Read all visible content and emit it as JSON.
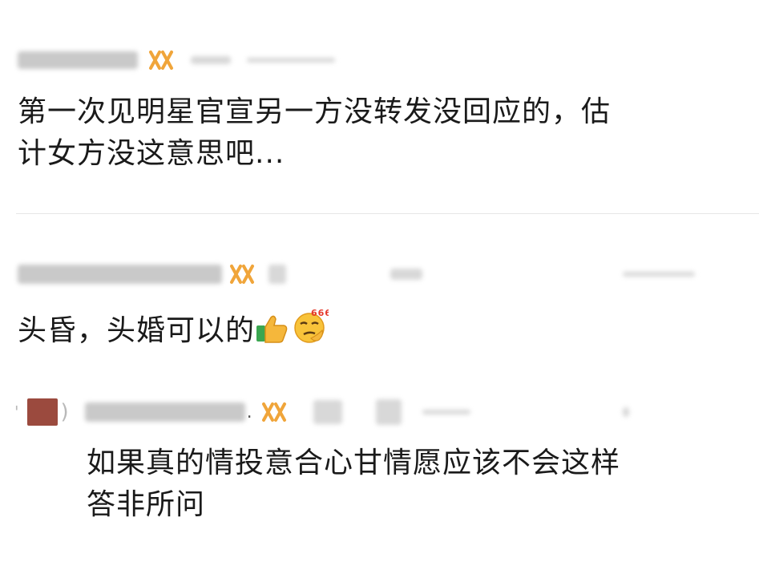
{
  "comments": [
    {
      "text": "第一次见明星官宣另一方没转发没回应的，估计女方没这意思吧...",
      "line1": "第一次见明星官宣另一方没转发没回应的，估",
      "line2": "计女方没这意思吧..."
    },
    {
      "text": "头昏，头婚可以的",
      "reactions": [
        "thumbs-up-icon",
        "666-face-icon"
      ],
      "badge": "666"
    },
    {
      "text": "如果真的情投意合心甘情愿应该不会这样答非所问",
      "line1": "如果真的情投意合心甘情愿应该不会这样",
      "line2": "答非所问",
      "is_reply": true
    }
  ],
  "colors": {
    "vip_icon": "#f0a53a",
    "divider": "#e6e6e6",
    "text": "#1a1a1a"
  },
  "icons": [
    "vip-badge-icon",
    "thumbs-up-icon",
    "666-face-icon"
  ]
}
